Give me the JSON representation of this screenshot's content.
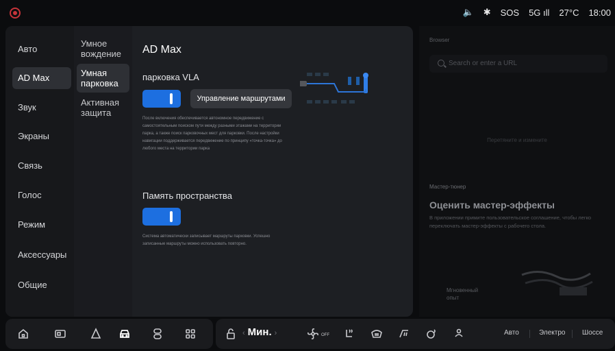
{
  "status_bar": {
    "sound": "🔈",
    "bluetooth": "✱",
    "sos": "SOS",
    "signal": "5G ıll",
    "temperature": "27°C",
    "time": "18:00"
  },
  "nav": {
    "items": [
      {
        "label": "Авто"
      },
      {
        "label": "AD Max"
      },
      {
        "label": "Звук"
      },
      {
        "label": "Экраны"
      },
      {
        "label": "Связь"
      },
      {
        "label": "Голос"
      },
      {
        "label": "Режим"
      },
      {
        "label": "Аксессуары"
      },
      {
        "label": "Общие"
      }
    ],
    "active_index": 1
  },
  "subnav": {
    "items": [
      {
        "label": "Умное вождение"
      },
      {
        "label": "Умная парковка"
      },
      {
        "label": "Активная защита"
      }
    ],
    "active_index": 1
  },
  "content": {
    "title": "AD Max",
    "vla": {
      "title": "парковка VLA",
      "enabled": true,
      "route_button": "Управление маршрутами",
      "description": "После включения обеспечивается автономное передвижение с самостоятельным поиском пути между разными этажами на территории парка, а также поиск парковочных мест для парковки. После настройки навигации поддерживается передвижение по принципу «точка-точка» до любого места на территории парка"
    },
    "memory": {
      "title": "Память пространства",
      "enabled": true,
      "description": "Система автоматически записывает маршруты парковки. Успешно записанные маршруты можно использовать повторно."
    }
  },
  "browser": {
    "label": "Browser",
    "search_placeholder": "Search or enter a URL",
    "middle_text": "Перетяните и измените"
  },
  "tuner": {
    "label": "Мастер-тюнер",
    "title": "Оценить мастер-эффекты",
    "description": "В приложении примите пользовательское соглашение, чтобы легко переключать мастер-эффекты с рабочего стола.",
    "mode": "Мгновенный опыт"
  },
  "dock": {
    "temp_label": "Мин.",
    "temp_left_arrow": "‹",
    "temp_right_arrow": "›",
    "fan_off": "OFF",
    "drive_modes": [
      "Авто",
      "Электро",
      "Шоссе"
    ]
  },
  "colors": {
    "accent": "#1d6fe0",
    "panel": "#1d1f23",
    "background": "#0b0c0e"
  }
}
